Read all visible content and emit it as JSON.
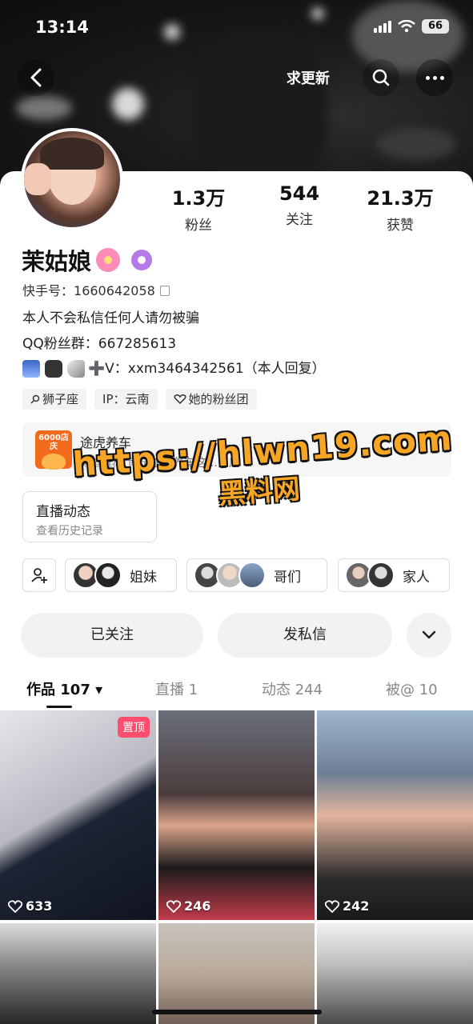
{
  "status_bar": {
    "time": "13:14",
    "battery": "66"
  },
  "nav": {
    "update_label": "求更新"
  },
  "stats": [
    {
      "value": "1.3万",
      "label": "粉丝"
    },
    {
      "value": "544",
      "label": "关注"
    },
    {
      "value": "21.3万",
      "label": "获赞"
    }
  ],
  "profile": {
    "name": "茉姑娘",
    "kuaishou_label": "快手号：",
    "kuaishou_id": "1660642058",
    "bio_line1": "本人不会私信任何人请勿被骗",
    "bio_line2": "QQ粉丝群：667285613",
    "bio_line3": "➕V：xxm3464342561（本人回复）"
  },
  "tags": [
    {
      "label": "狮子座",
      "icon": "search-icon"
    },
    {
      "label": "IP：云南",
      "icon": ""
    },
    {
      "label": "她的粉丝团",
      "icon": "heart-icon"
    }
  ],
  "shop": {
    "name": "途虎养车",
    "tag": "粉丝推荐",
    "desc": "南宁途虎养车这…到店",
    "logo_text": "6000店庆"
  },
  "live": {
    "title": "直播动态",
    "subtitle": "查看历史记录"
  },
  "watermark": {
    "line1": "https://hlwn19.com",
    "line2": "黑料网"
  },
  "relations": [
    {
      "label": "姐妹"
    },
    {
      "label": "哥们"
    },
    {
      "label": "家人"
    }
  ],
  "actions": {
    "follow": "已关注",
    "message": "发私信"
  },
  "tabs": [
    {
      "label": "作品 107 ▾",
      "active": true
    },
    {
      "label": "直播 1",
      "active": false
    },
    {
      "label": "动态 244",
      "active": false
    },
    {
      "label": "被@ 10",
      "active": false
    }
  ],
  "grid": [
    {
      "likes": "633",
      "pinned": "置顶"
    },
    {
      "likes": "246"
    },
    {
      "likes": "242"
    },
    {},
    {},
    {}
  ],
  "colors": {
    "accent": "#ff4d6d",
    "watermark": "#f6a524",
    "shop_logo": "#f26a1b"
  }
}
